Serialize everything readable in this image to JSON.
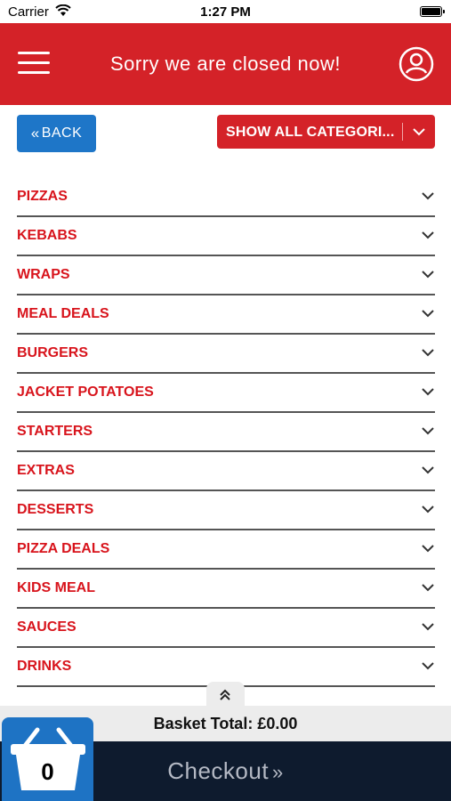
{
  "status_bar": {
    "carrier": "Carrier",
    "time": "1:27 PM"
  },
  "header": {
    "title": "Sorry we are closed now!",
    "icons": [
      "hamburger-menu-icon",
      "user-profile-icon"
    ],
    "background_color": "#d42228"
  },
  "toolbar": {
    "back_label": "BACK",
    "back_color": "#1e76c8",
    "category_select_value": "SHOW ALL CATEGORI...",
    "category_select_color": "#d42228"
  },
  "categories": [
    {
      "name": "PIZZAS"
    },
    {
      "name": "KEBABS"
    },
    {
      "name": "WRAPS"
    },
    {
      "name": "MEAL DEALS"
    },
    {
      "name": "BURGERS"
    },
    {
      "name": "JACKET POTATOES"
    },
    {
      "name": "STARTERS"
    },
    {
      "name": "EXTRAS"
    },
    {
      "name": "DESSERTS"
    },
    {
      "name": "PIZZA DEALS"
    },
    {
      "name": "KIDS MEAL"
    },
    {
      "name": "SAUCES"
    },
    {
      "name": "DRINKS"
    }
  ],
  "category_text_color": "#d8141c",
  "basket": {
    "total_label": "Basket Total: £0.00",
    "count": "0",
    "checkout_label": "Checkout",
    "checkout_chevrons": "»"
  }
}
